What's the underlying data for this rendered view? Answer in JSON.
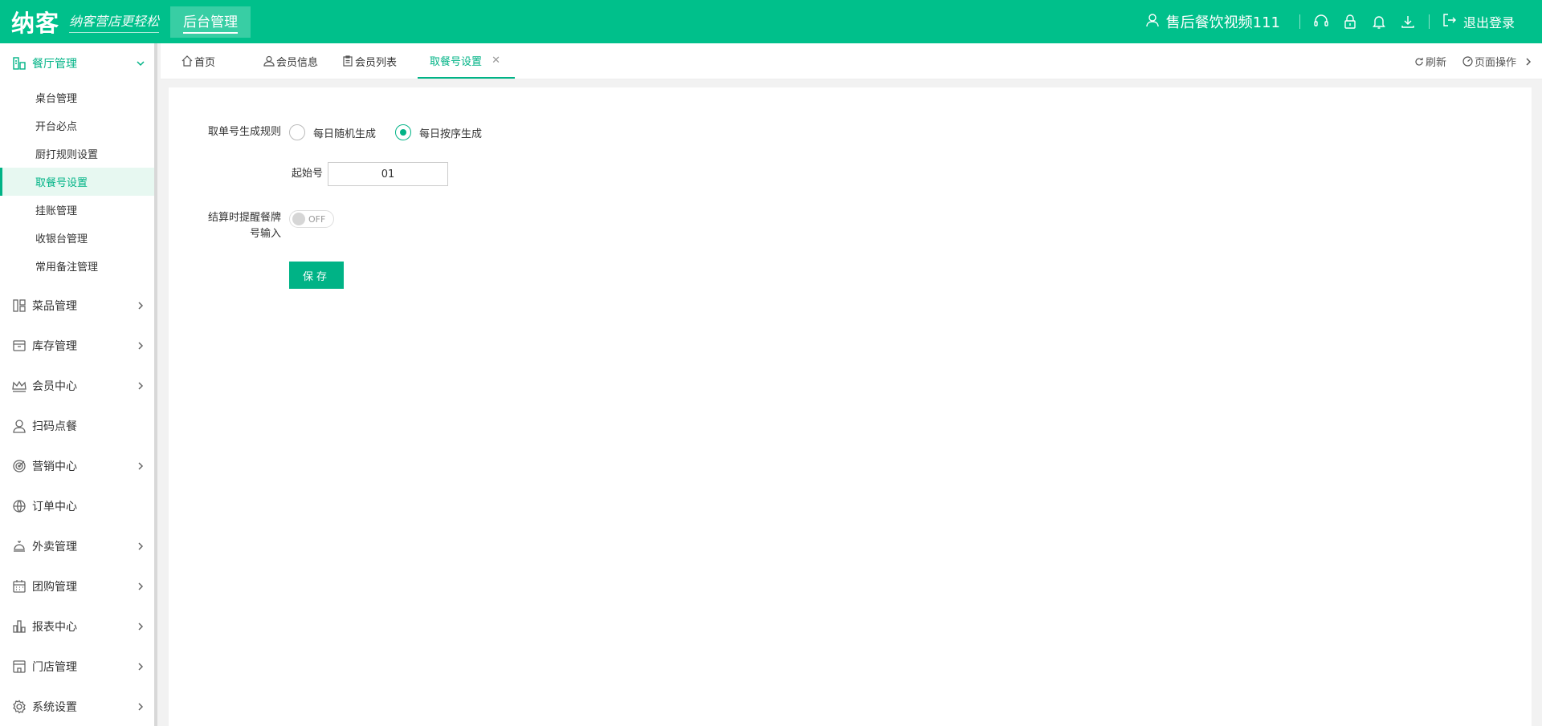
{
  "colors": {
    "brand": "#00c08b",
    "accent": "#00b386"
  },
  "header": {
    "logo": "纳客",
    "slogan": "纳客营店更轻松",
    "module_tab": "后台管理",
    "user_name": "售后餐饮视频111",
    "logout": "退出登录",
    "icons": [
      "headset-icon",
      "lock-icon",
      "bell-icon",
      "download-icon"
    ]
  },
  "sidebar": {
    "groups": [
      {
        "label": "餐厅管理",
        "icon": "restaurant-icon",
        "expanded": true,
        "items": [
          {
            "label": "桌台管理"
          },
          {
            "label": "开台必点"
          },
          {
            "label": "厨打规则设置"
          },
          {
            "label": "取餐号设置",
            "active": true
          },
          {
            "label": "挂账管理"
          },
          {
            "label": "收银台管理"
          },
          {
            "label": "常用备注管理"
          }
        ]
      },
      {
        "label": "菜品管理",
        "icon": "dishes-icon",
        "arrow": true
      },
      {
        "label": "库存管理",
        "icon": "inventory-icon",
        "arrow": true
      },
      {
        "label": "会员中心",
        "icon": "crown-icon",
        "arrow": true
      },
      {
        "label": "扫码点餐",
        "icon": "user-icon",
        "arrow": false
      },
      {
        "label": "营销中心",
        "icon": "target-icon",
        "arrow": true
      },
      {
        "label": "订单中心",
        "icon": "globe-icon",
        "arrow": false
      },
      {
        "label": "外卖管理",
        "icon": "service-bell-icon",
        "arrow": true
      },
      {
        "label": "团购管理",
        "icon": "calendar-icon",
        "arrow": true
      },
      {
        "label": "报表中心",
        "icon": "bar-chart-icon",
        "arrow": true
      },
      {
        "label": "门店管理",
        "icon": "store-icon",
        "arrow": true
      },
      {
        "label": "系统设置",
        "icon": "gear-icon",
        "arrow": true
      }
    ]
  },
  "tabs": [
    {
      "label": "首页",
      "icon": "home-icon"
    },
    {
      "label": "会员信息",
      "icon": "user-icon"
    },
    {
      "label": "会员列表",
      "icon": "clipboard-icon"
    },
    {
      "label": "取餐号设置",
      "active": true,
      "closable": true
    }
  ],
  "tab_actions": {
    "refresh": "刷新",
    "page_ops": "页面操作"
  },
  "form": {
    "rule_label": "取单号生成规则",
    "rule_options": [
      "每日随机生成",
      "每日按序生成"
    ],
    "rule_selected": "每日按序生成",
    "start_label": "起始号",
    "start_value": "01",
    "remind_label_line1": "结算时提醒餐牌",
    "remind_label_line2": "号输入",
    "remind_toggle": "OFF",
    "save": "保存"
  }
}
